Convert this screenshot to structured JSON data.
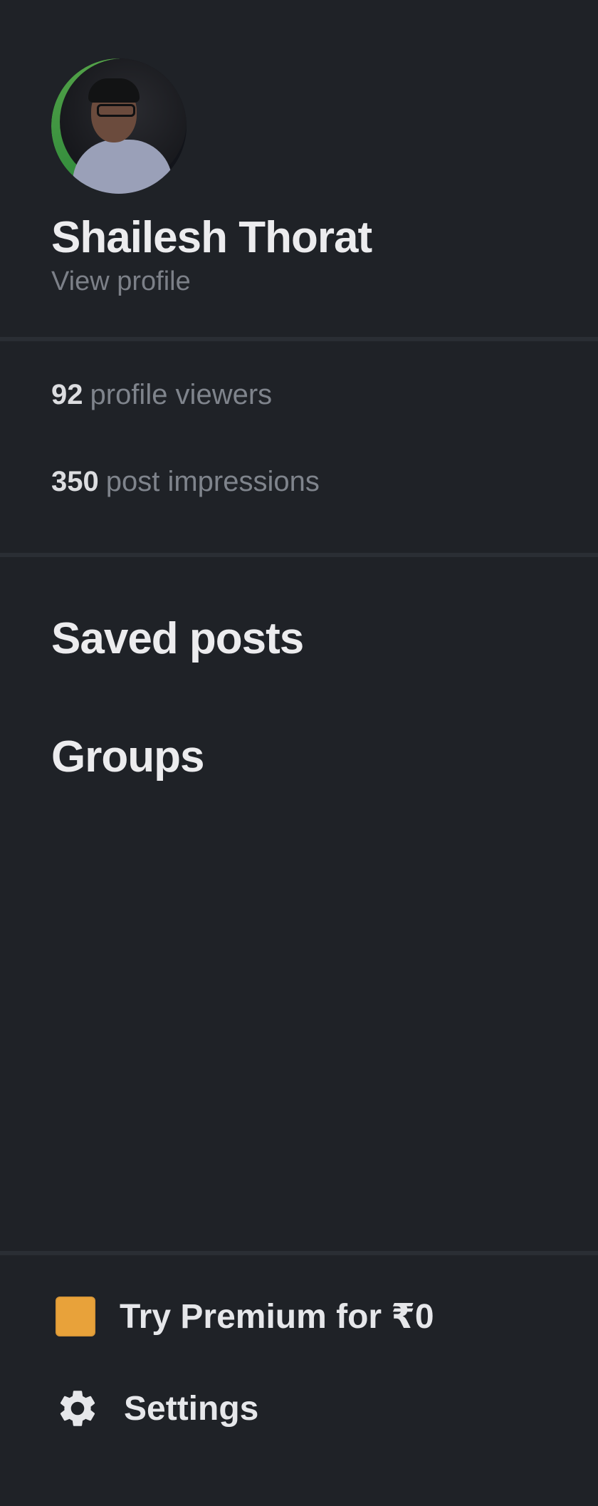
{
  "profile": {
    "name": "Shailesh Thorat",
    "view_profile_label": "View profile"
  },
  "stats": [
    {
      "value": "92",
      "label": "profile viewers"
    },
    {
      "value": "350",
      "label": "post impressions"
    }
  ],
  "nav": {
    "saved_posts": "Saved posts",
    "groups": "Groups"
  },
  "bottom": {
    "premium_label": "Try Premium for ₹0",
    "settings_label": "Settings"
  },
  "icons": {
    "premium": "premium-icon",
    "settings": "gear-icon"
  },
  "colors": {
    "background": "#1f2227",
    "premium_accent": "#e8a23a",
    "avatar_ring": "#58a54a"
  }
}
